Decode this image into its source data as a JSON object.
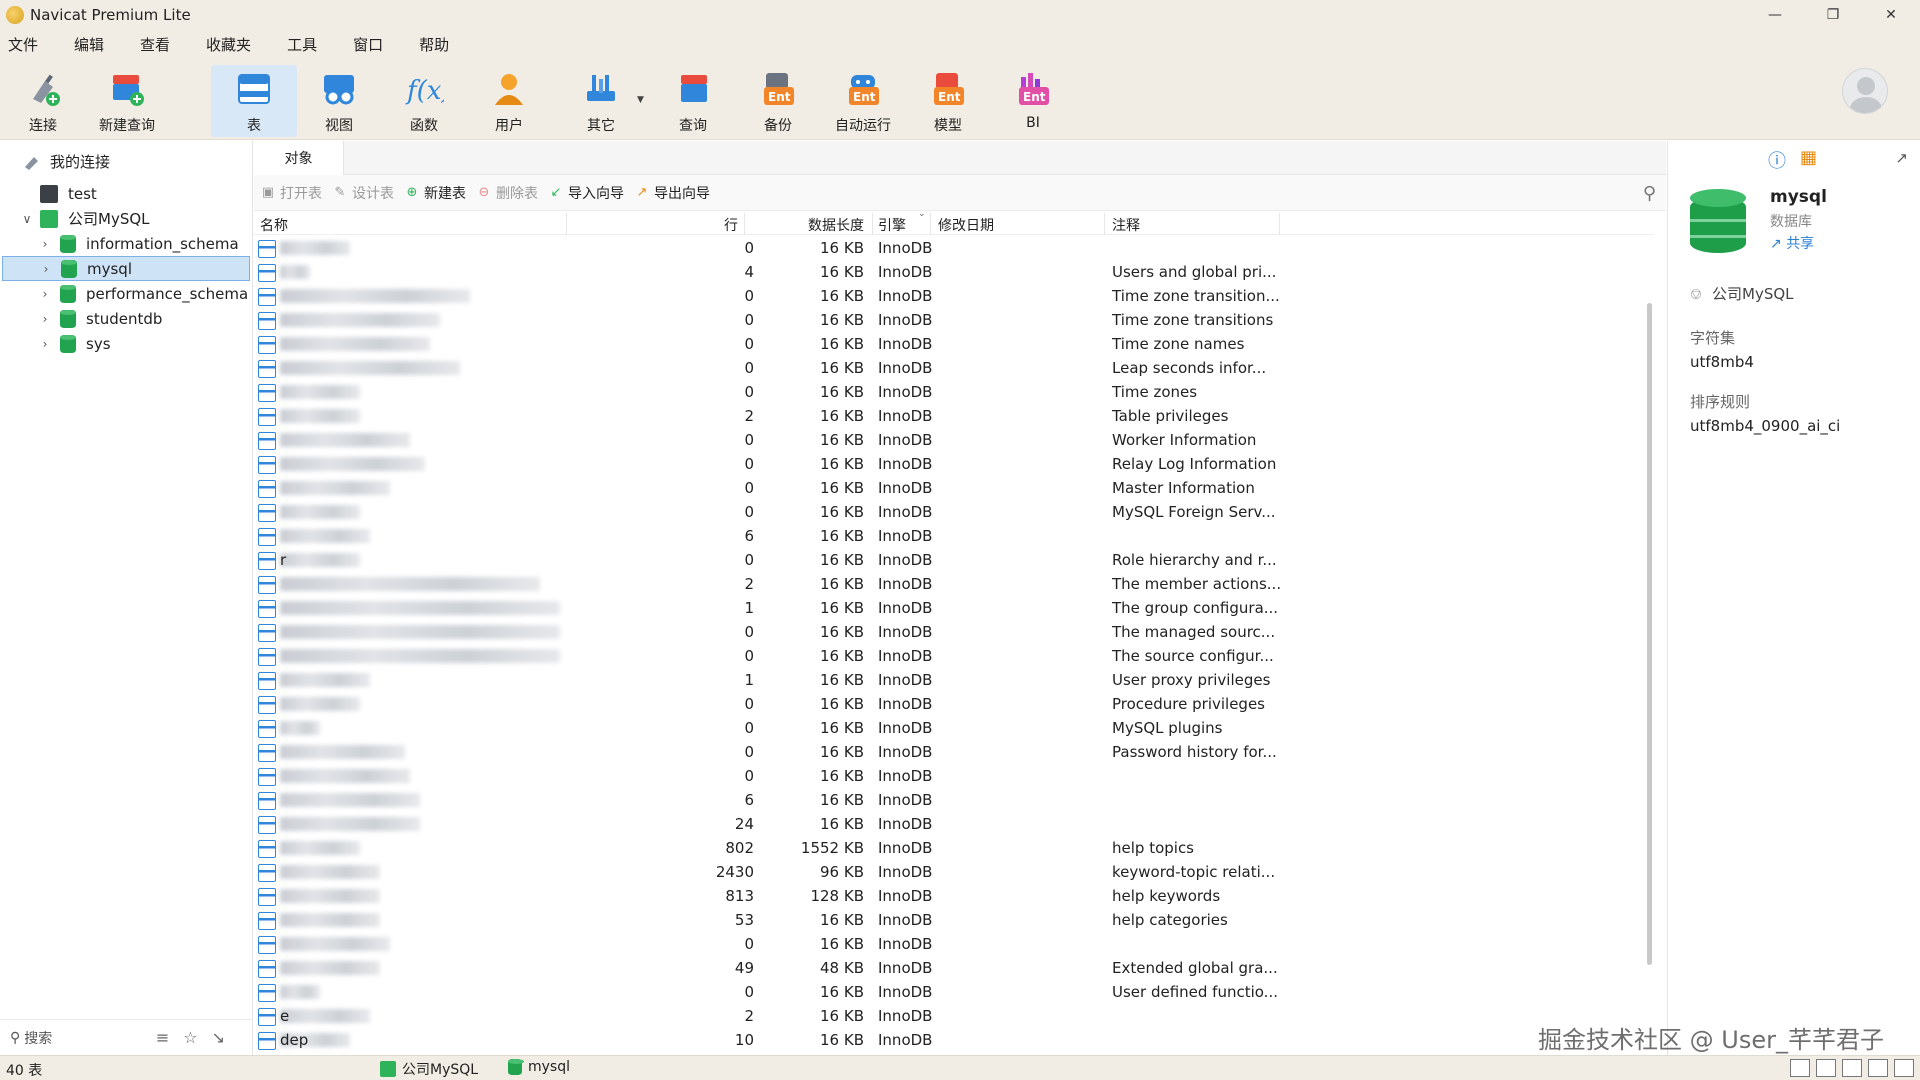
{
  "window": {
    "title": "Navicat Premium Lite"
  },
  "menu": [
    "文件",
    "编辑",
    "查看",
    "收藏夹",
    "工具",
    "窗口",
    "帮助"
  ],
  "toolbar": [
    {
      "label": "连接",
      "icon": "plug-connect-icon"
    },
    {
      "label": "新建查询",
      "icon": "new-query-icon"
    },
    {
      "label": "表",
      "icon": "table-icon",
      "active": true
    },
    {
      "label": "视图",
      "icon": "view-icon"
    },
    {
      "label": "函数",
      "icon": "function-icon"
    },
    {
      "label": "用户",
      "icon": "user-icon"
    },
    {
      "label": "其它",
      "icon": "tools-icon"
    },
    {
      "label": "查询",
      "icon": "query-icon"
    },
    {
      "label": "备份",
      "icon": "backup-ent-icon"
    },
    {
      "label": "自动运行",
      "icon": "automation-ent-icon"
    },
    {
      "label": "模型",
      "icon": "model-ent-icon"
    },
    {
      "label": "BI",
      "icon": "bi-ent-icon"
    }
  ],
  "sidebar": {
    "root": "我的连接",
    "connections": [
      {
        "label": "test"
      },
      {
        "label": "公司MySQL",
        "expanded": true,
        "databases": [
          "information_schema",
          "mysql",
          "performance_schema",
          "studentdb",
          "sys"
        ],
        "selected": "mysql"
      }
    ],
    "search_placeholder": "搜索"
  },
  "main": {
    "tab": "对象",
    "actions": [
      {
        "label": "打开表",
        "enabled": false
      },
      {
        "label": "设计表",
        "enabled": false
      },
      {
        "label": "新建表",
        "enabled": true
      },
      {
        "label": "删除表",
        "enabled": false
      },
      {
        "label": "导入向导",
        "enabled": true
      },
      {
        "label": "导出向导",
        "enabled": true
      }
    ],
    "columns": {
      "name": "名称",
      "rows": "行",
      "size": "数据长度",
      "engine": "引擎",
      "modified": "修改日期",
      "comment": "注释"
    },
    "tables": [
      {
        "prefix": "",
        "rows": "0",
        "size": "16 KB",
        "engine": "InnoDB",
        "comment": ""
      },
      {
        "prefix": "",
        "rows": "4",
        "size": "16 KB",
        "engine": "InnoDB",
        "comment": "Users and global pri..."
      },
      {
        "prefix": "",
        "rows": "0",
        "size": "16 KB",
        "engine": "InnoDB",
        "comment": "Time zone transition..."
      },
      {
        "prefix": "",
        "rows": "0",
        "size": "16 KB",
        "engine": "InnoDB",
        "comment": "Time zone transitions"
      },
      {
        "prefix": "",
        "rows": "0",
        "size": "16 KB",
        "engine": "InnoDB",
        "comment": "Time zone names"
      },
      {
        "prefix": "",
        "rows": "0",
        "size": "16 KB",
        "engine": "InnoDB",
        "comment": "Leap seconds infor..."
      },
      {
        "prefix": "",
        "rows": "0",
        "size": "16 KB",
        "engine": "InnoDB",
        "comment": "Time zones"
      },
      {
        "prefix": "",
        "rows": "2",
        "size": "16 KB",
        "engine": "InnoDB",
        "comment": "Table privileges"
      },
      {
        "prefix": "",
        "rows": "0",
        "size": "16 KB",
        "engine": "InnoDB",
        "comment": "Worker Information"
      },
      {
        "prefix": "",
        "rows": "0",
        "size": "16 KB",
        "engine": "InnoDB",
        "comment": "Relay Log Information"
      },
      {
        "prefix": "",
        "rows": "0",
        "size": "16 KB",
        "engine": "InnoDB",
        "comment": "Master Information"
      },
      {
        "prefix": "",
        "rows": "0",
        "size": "16 KB",
        "engine": "InnoDB",
        "comment": "MySQL Foreign Serv..."
      },
      {
        "prefix": "",
        "rows": "6",
        "size": "16 KB",
        "engine": "InnoDB",
        "comment": ""
      },
      {
        "prefix": "r",
        "rows": "0",
        "size": "16 KB",
        "engine": "InnoDB",
        "comment": "Role hierarchy and r..."
      },
      {
        "prefix": "",
        "rows": "2",
        "size": "16 KB",
        "engine": "InnoDB",
        "comment": "The member actions..."
      },
      {
        "prefix": "",
        "rows": "1",
        "size": "16 KB",
        "engine": "InnoDB",
        "comment": "The group configura..."
      },
      {
        "prefix": "",
        "rows": "0",
        "size": "16 KB",
        "engine": "InnoDB",
        "comment": "The managed sourc..."
      },
      {
        "prefix": "",
        "rows": "0",
        "size": "16 KB",
        "engine": "InnoDB",
        "comment": "The source configur..."
      },
      {
        "prefix": "",
        "rows": "1",
        "size": "16 KB",
        "engine": "InnoDB",
        "comment": "User proxy privileges"
      },
      {
        "prefix": "",
        "rows": "0",
        "size": "16 KB",
        "engine": "InnoDB",
        "comment": "Procedure privileges"
      },
      {
        "prefix": "",
        "rows": "0",
        "size": "16 KB",
        "engine": "InnoDB",
        "comment": "MySQL plugins"
      },
      {
        "prefix": "",
        "rows": "0",
        "size": "16 KB",
        "engine": "InnoDB",
        "comment": "Password history for..."
      },
      {
        "prefix": "",
        "rows": "0",
        "size": "16 KB",
        "engine": "InnoDB",
        "comment": ""
      },
      {
        "prefix": "",
        "rows": "6",
        "size": "16 KB",
        "engine": "InnoDB",
        "comment": ""
      },
      {
        "prefix": "",
        "rows": "24",
        "size": "16 KB",
        "engine": "InnoDB",
        "comment": ""
      },
      {
        "prefix": "",
        "rows": "802",
        "size": "1552 KB",
        "engine": "InnoDB",
        "comment": "help topics"
      },
      {
        "prefix": "",
        "rows": "2430",
        "size": "96 KB",
        "engine": "InnoDB",
        "comment": "keyword-topic relati..."
      },
      {
        "prefix": "",
        "rows": "813",
        "size": "128 KB",
        "engine": "InnoDB",
        "comment": "help keywords"
      },
      {
        "prefix": "",
        "rows": "53",
        "size": "16 KB",
        "engine": "InnoDB",
        "comment": "help categories"
      },
      {
        "prefix": "",
        "rows": "0",
        "size": "16 KB",
        "engine": "InnoDB",
        "comment": ""
      },
      {
        "prefix": "",
        "rows": "49",
        "size": "48 KB",
        "engine": "InnoDB",
        "comment": "Extended global gra..."
      },
      {
        "prefix": "",
        "rows": "0",
        "size": "16 KB",
        "engine": "InnoDB",
        "comment": "User defined functio..."
      },
      {
        "prefix": "e",
        "rows": "2",
        "size": "16 KB",
        "engine": "InnoDB",
        "comment": ""
      },
      {
        "prefix": "dep",
        "rows": "10",
        "size": "16 KB",
        "engine": "InnoDB",
        "comment": ""
      }
    ]
  },
  "details": {
    "name": "mysql",
    "type": "数据库",
    "share": "共享",
    "connection": "公司MySQL",
    "charset_label": "字符集",
    "charset": "utf8mb4",
    "collation_label": "排序规则",
    "collation": "utf8mb4_0900_ai_ci"
  },
  "status": {
    "count": "40 表",
    "connection": "公司MySQL",
    "database": "mysql"
  },
  "watermark": "掘金技术社区 @ User_芊芊君子",
  "colors": {
    "accent": "#2f86db",
    "db_green": "#22a350",
    "selection": "#cfe3f7",
    "chrome": "#f2ede4"
  }
}
